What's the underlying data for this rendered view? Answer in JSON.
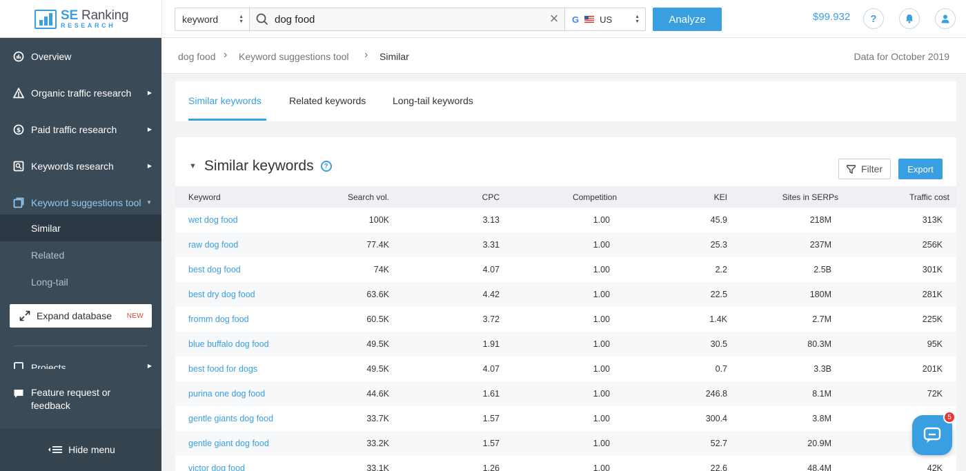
{
  "brand": {
    "logo_main_a": "SE",
    "logo_main_b": "Ranking",
    "logo_sub": "RESEARCH"
  },
  "search": {
    "type_value": "keyword",
    "query": "dog food",
    "region_engine": "G",
    "region_code": "US",
    "analyze_label": "Analyze"
  },
  "header": {
    "balance": "$99.932",
    "help_glyph": "?"
  },
  "sidebar": {
    "items": [
      {
        "label": "Overview",
        "icon": "overview-icon"
      },
      {
        "label": "Organic traffic research",
        "icon": "organic-icon"
      },
      {
        "label": "Paid traffic research",
        "icon": "dollar-icon"
      },
      {
        "label": "Keywords research",
        "icon": "keywords-icon"
      },
      {
        "label": "Keyword suggestions tool",
        "icon": "suggestions-icon"
      }
    ],
    "sub_items": [
      "Similar",
      "Related",
      "Long-tail"
    ],
    "expand_label": "Expand database",
    "expand_tag": "NEW",
    "projects_label": "Projects",
    "feedback_label_1": "Feature request or",
    "feedback_label_2": "feedback",
    "hide_menu_label": "Hide menu"
  },
  "breadcrumb": {
    "items": [
      "dog food",
      "Keyword suggestions tool",
      "Similar"
    ],
    "data_for": "Data for October 2019"
  },
  "tabs": [
    "Similar keywords",
    "Related keywords",
    "Long-tail keywords"
  ],
  "section": {
    "title": "Similar keywords",
    "help_glyph": "?",
    "filter_label": "Filter",
    "export_label": "Export"
  },
  "table": {
    "columns": [
      "Keyword",
      "Search vol.",
      "CPC",
      "Competition",
      "KEI",
      "Sites in SERPs",
      "Traffic cost"
    ],
    "rows": [
      {
        "keyword": "wet dog food",
        "vol": "100K",
        "cpc": "3.13",
        "comp": "1.00",
        "kei": "45.9",
        "serp": "218M",
        "cost": "313K"
      },
      {
        "keyword": "raw dog food",
        "vol": "77.4K",
        "cpc": "3.31",
        "comp": "1.00",
        "kei": "25.3",
        "serp": "237M",
        "cost": "256K"
      },
      {
        "keyword": "best dog food",
        "vol": "74K",
        "cpc": "4.07",
        "comp": "1.00",
        "kei": "2.2",
        "serp": "2.5B",
        "cost": "301K"
      },
      {
        "keyword": "best dry dog food",
        "vol": "63.6K",
        "cpc": "4.42",
        "comp": "1.00",
        "kei": "22.5",
        "serp": "180M",
        "cost": "281K"
      },
      {
        "keyword": "fromm dog food",
        "vol": "60.5K",
        "cpc": "3.72",
        "comp": "1.00",
        "kei": "1.4K",
        "serp": "2.7M",
        "cost": "225K"
      },
      {
        "keyword": "blue buffalo dog food",
        "vol": "49.5K",
        "cpc": "1.91",
        "comp": "1.00",
        "kei": "30.5",
        "serp": "80.3M",
        "cost": "95K"
      },
      {
        "keyword": "best food for dogs",
        "vol": "49.5K",
        "cpc": "4.07",
        "comp": "1.00",
        "kei": "0.7",
        "serp": "3.3B",
        "cost": "201K"
      },
      {
        "keyword": "purina one dog food",
        "vol": "44.6K",
        "cpc": "1.61",
        "comp": "1.00",
        "kei": "246.8",
        "serp": "8.1M",
        "cost": "72K"
      },
      {
        "keyword": "gentle giants dog food",
        "vol": "33.7K",
        "cpc": "1.57",
        "comp": "1.00",
        "kei": "300.4",
        "serp": "3.8M",
        "cost": ""
      },
      {
        "keyword": "gentle giant dog food",
        "vol": "33.2K",
        "cpc": "1.57",
        "comp": "1.00",
        "kei": "52.7",
        "serp": "20.9M",
        "cost": ""
      },
      {
        "keyword": "victor dog food",
        "vol": "33.1K",
        "cpc": "1.26",
        "comp": "1.00",
        "kei": "22.6",
        "serp": "48.4M",
        "cost": "42K"
      }
    ]
  },
  "chat": {
    "badge": "5"
  },
  "colors": {
    "accent": "#3a9fe0",
    "sidebar": "#3b4a57",
    "new_tag": "#e0452f"
  }
}
